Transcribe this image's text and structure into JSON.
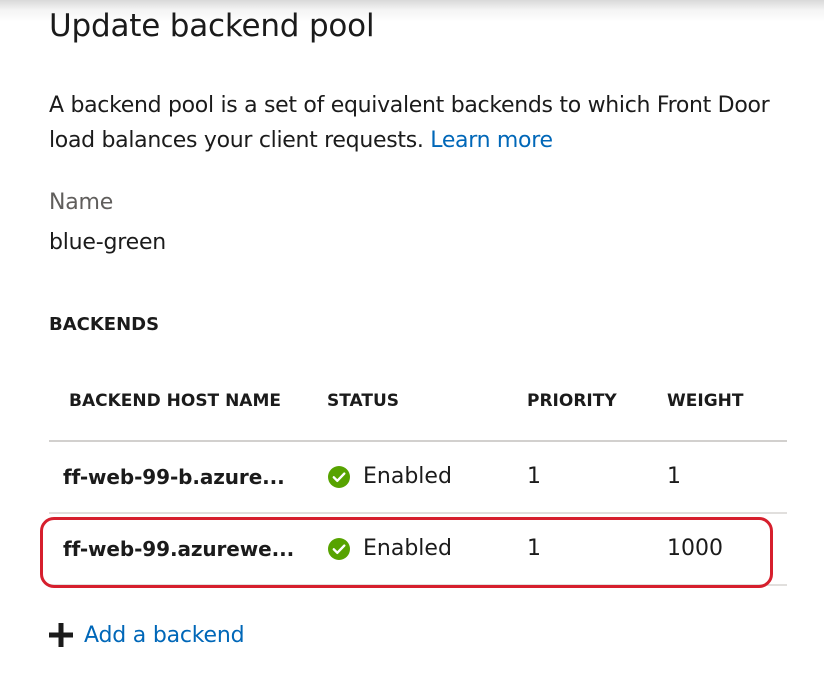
{
  "panel": {
    "title": "Update backend pool",
    "description": "A backend pool is a set of equivalent backends to which Front Door load balances your client requests.",
    "learn_more": "Learn more"
  },
  "name": {
    "label": "Name",
    "value": "blue-green"
  },
  "backends": {
    "heading": "BACKENDS",
    "columns": [
      "BACKEND HOST NAME",
      "STATUS",
      "PRIORITY",
      "WEIGHT"
    ],
    "rows": [
      {
        "host": "ff-web-99-b.azure...",
        "status": "Enabled",
        "priority": "1",
        "weight": "1",
        "highlighted": false
      },
      {
        "host": "ff-web-99.azurewe...",
        "status": "Enabled",
        "priority": "1",
        "weight": "1000",
        "highlighted": true
      }
    ],
    "add_label": "Add a backend"
  },
  "colors": {
    "link": "#0067b8",
    "status_ok": "#57a300",
    "highlight": "#d61f2d"
  },
  "icons": {
    "status": "check-circle-icon",
    "add": "plus-icon"
  }
}
